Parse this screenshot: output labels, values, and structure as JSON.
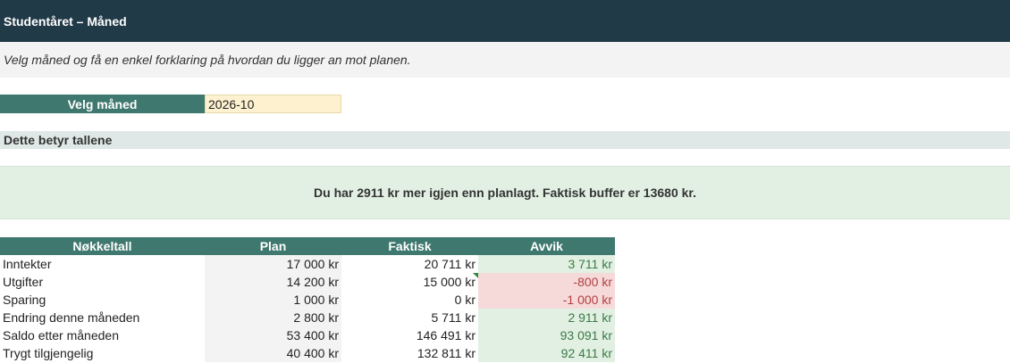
{
  "header": {
    "title": "Studentåret – Måned"
  },
  "intro": {
    "text": "Velg måned og få en enkel forklaring på hvordan du ligger an mot planen."
  },
  "selector": {
    "label": "Velg måned",
    "value": "2026-10"
  },
  "section": {
    "title": "Dette betyr tallene"
  },
  "summary": {
    "text": "Du har 2911 kr mer igjen enn planlagt. Faktisk buffer er 13680 kr."
  },
  "table": {
    "headers": [
      "Nøkkeltall",
      "Plan",
      "Faktisk",
      "Avvik"
    ],
    "rows": [
      {
        "name": "Inntekter",
        "plan": "17 000 kr",
        "actual": "20 711 kr",
        "deviation": "3 711 kr",
        "status": "pos"
      },
      {
        "name": "Utgifter",
        "plan": "14 200 kr",
        "actual": "15 000 kr",
        "deviation": "-800 kr",
        "status": "neg"
      },
      {
        "name": "Sparing",
        "plan": "1 000 kr",
        "actual": "0 kr",
        "deviation": "-1 000 kr",
        "status": "neg"
      },
      {
        "name": "Endring denne måneden",
        "plan": "2 800 kr",
        "actual": "5 711 kr",
        "deviation": "2 911 kr",
        "status": "pos"
      },
      {
        "name": "Saldo etter måneden",
        "plan": "53 400 kr",
        "actual": "146 491 kr",
        "deviation": "93 091 kr",
        "status": "pos"
      },
      {
        "name": "Trygt tilgjengelig",
        "plan": "40 400 kr",
        "actual": "132 811 kr",
        "deviation": "92 411 kr",
        "status": "pos"
      }
    ]
  },
  "colors": {
    "header_bg": "#213a48",
    "accent_teal": "#3f786e",
    "positive_bg": "#e2f0e3",
    "negative_bg": "#f6d9d9",
    "input_bg": "#fdf1cf"
  }
}
